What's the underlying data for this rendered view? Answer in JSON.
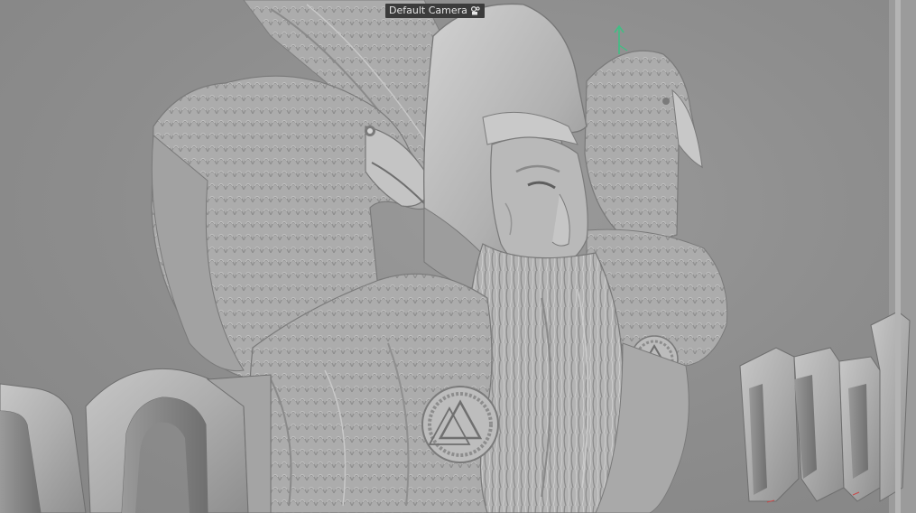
{
  "viewport": {
    "camera_label": "Default Camera",
    "camera_icon": "camera-icon",
    "axis_gizmo_icon": "y-axis-gizmo-icon",
    "background_color": "#8d8d8d",
    "model_color": "#b5b5b5",
    "axis_color": "#3fbf84"
  }
}
